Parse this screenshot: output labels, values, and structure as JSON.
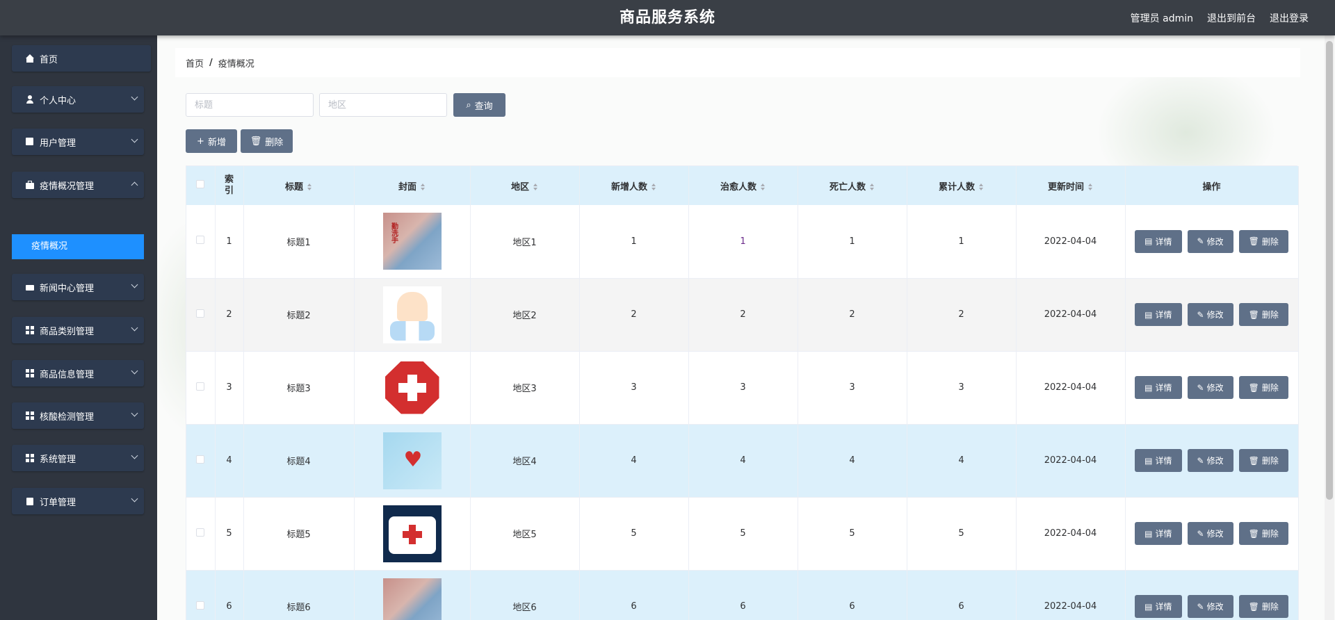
{
  "app": {
    "title": "商品服务系统"
  },
  "top_links": {
    "admin": "管理员 admin",
    "front": "退出到前台",
    "logout": "退出登录"
  },
  "sidebar": {
    "items": [
      {
        "label": "首页",
        "icon": "home-icon"
      },
      {
        "label": "个人中心",
        "icon": "user-icon"
      },
      {
        "label": "用户管理",
        "icon": "chart-icon"
      },
      {
        "label": "疫情概况管理",
        "icon": "bag-icon"
      },
      {
        "label": "新闻中心管理",
        "icon": "news-icon"
      },
      {
        "label": "商品类别管理",
        "icon": "grid-icon"
      },
      {
        "label": "商品信息管理",
        "icon": "grid-icon"
      },
      {
        "label": "核酸检测管理",
        "icon": "grid-icon"
      },
      {
        "label": "系统管理",
        "icon": "grid-icon"
      },
      {
        "label": "订单管理",
        "icon": "clipboard-icon"
      }
    ],
    "active_sub": "疫情概况"
  },
  "breadcrumb": {
    "home": "首页",
    "sep": "/",
    "current": "疫情概况"
  },
  "search": {
    "title_placeholder": "标题",
    "region_placeholder": "地区",
    "query_label": "查询"
  },
  "actions": {
    "add_label": "新增",
    "delete_label": "删除"
  },
  "table": {
    "headers": {
      "index": "索引",
      "title": "标题",
      "cover": "封面",
      "region": "地区",
      "new": "新增人数",
      "cured": "治愈人数",
      "dead": "死亡人数",
      "total": "累计人数",
      "updated": "更新时间",
      "ops": "操作"
    },
    "row_buttons": {
      "detail": "详情",
      "edit": "修改",
      "delete": "删除"
    },
    "rows": [
      {
        "index": "1",
        "title": "标题1",
        "region": "地区1",
        "new": "1",
        "cured": "1",
        "dead": "1",
        "total": "1",
        "updated": "2022-04-04"
      },
      {
        "index": "2",
        "title": "标题2",
        "region": "地区2",
        "new": "2",
        "cured": "2",
        "dead": "2",
        "total": "2",
        "updated": "2022-04-04"
      },
      {
        "index": "3",
        "title": "标题3",
        "region": "地区3",
        "new": "3",
        "cured": "3",
        "dead": "3",
        "total": "3",
        "updated": "2022-04-04"
      },
      {
        "index": "4",
        "title": "标题4",
        "region": "地区4",
        "new": "4",
        "cured": "4",
        "dead": "4",
        "total": "4",
        "updated": "2022-04-04"
      },
      {
        "index": "5",
        "title": "标题5",
        "region": "地区5",
        "new": "5",
        "cured": "5",
        "dead": "5",
        "total": "5",
        "updated": "2022-04-04"
      },
      {
        "index": "6",
        "title": "标题6",
        "region": "地区6",
        "new": "6",
        "cured": "6",
        "dead": "6",
        "total": "6",
        "updated": "2022-04-04"
      }
    ]
  },
  "colors": {
    "topbar": "#3a3f46",
    "sidebar": "#2f353f",
    "menu_item": "#2d3a4f",
    "active": "#1e90ff",
    "button": "#5f7088",
    "header_row": "#dcf0fb"
  }
}
